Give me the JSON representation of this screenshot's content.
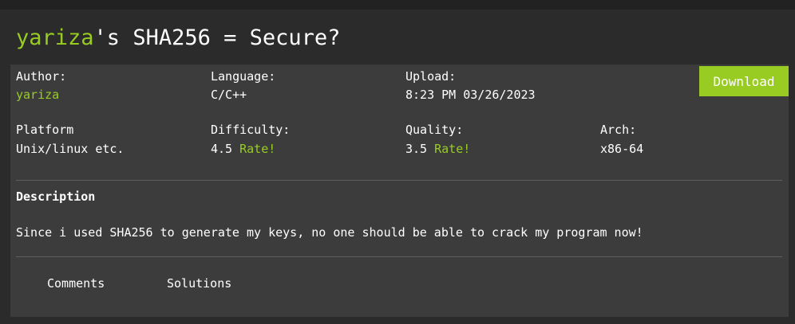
{
  "header": {
    "username": "yariza",
    "title_suffix": "'s SHA256 = Secure?"
  },
  "actions": {
    "download_label": "Download"
  },
  "meta": {
    "author_label": "Author:",
    "author_value": "yariza",
    "language_label": "Language:",
    "language_value": "C/C++",
    "upload_label": "Upload:",
    "upload_value": "8:23 PM 03/26/2023",
    "platform_label": "Platform",
    "platform_value": "Unix/linux etc.",
    "difficulty_label": "Difficulty:",
    "difficulty_value": "4.5",
    "difficulty_rate": "Rate!",
    "quality_label": "Quality:",
    "quality_value": "3.5",
    "quality_rate": "Rate!",
    "arch_label": "Arch:",
    "arch_value": "x86-64"
  },
  "description": {
    "heading": "Description",
    "text": "Since i used SHA256 to generate my keys, no one should be able to crack my program now!"
  },
  "tabs": [
    {
      "label": "Comments"
    },
    {
      "label": "Solutions"
    }
  ],
  "colors": {
    "accent": "#99cc22",
    "page_background": "#2b2b2b",
    "panel_background": "#3c3c3c",
    "top_bar": "#222222",
    "divider": "#5e5e5e"
  }
}
